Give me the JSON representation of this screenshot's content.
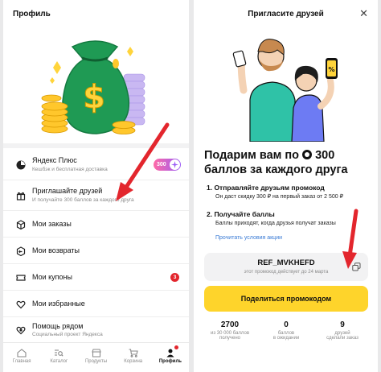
{
  "left": {
    "title": "Профиль",
    "plus": {
      "title": "Яндекс Плюс",
      "subtitle": "Кешбэк и бесплатная доставка",
      "points": "300"
    },
    "invite": {
      "title": "Приглашайте друзей",
      "subtitle": "И получайте 300 баллов за каждого друга"
    },
    "orders": "Мои заказы",
    "returns": "Мои возвраты",
    "coupons": "Мои купоны",
    "coupons_badge": "3",
    "favorites": "Мои избранные",
    "help": {
      "title": "Помощь рядом",
      "subtitle": "Социальный проект Яндекса"
    },
    "tabs": [
      "Главная",
      "Каталог",
      "Продукты",
      "Корзина",
      "Профиль"
    ],
    "hero_currency": "$"
  },
  "right": {
    "title": "Пригласите друзей",
    "headline_1": "Подарим вам по",
    "headline_points": "300",
    "headline_2": "баллов за каждого друга",
    "step1_title": "1. Отправляйте друзьям промокод",
    "step1_text": "Он даст скидку 300 ₽ на первый заказ от 2 500 ₽",
    "step2_title": "2. Получайте баллы",
    "step2_text": "Баллы приходят, когда друзья получат заказы",
    "terms_link": "Прочитать условия акции",
    "promo_code": "REF_MVKHEFD",
    "promo_valid": "этот промокод действует до 24 марта",
    "share_button": "Поделиться промокодом",
    "phone_badge": "%",
    "stats": [
      {
        "value": "2700",
        "label1": "из 30 000 баллов",
        "label2": "получено"
      },
      {
        "value": "0",
        "label1": "баллов",
        "label2": "в ожидании"
      },
      {
        "value": "9",
        "label1": "друзей",
        "label2": "сделали заказ"
      }
    ]
  },
  "colors": {
    "accent_yellow": "#fed42b",
    "arrow_red": "#e3262d",
    "plus_purple": "#9b5cf6",
    "link_blue": "#3a7bd5"
  }
}
